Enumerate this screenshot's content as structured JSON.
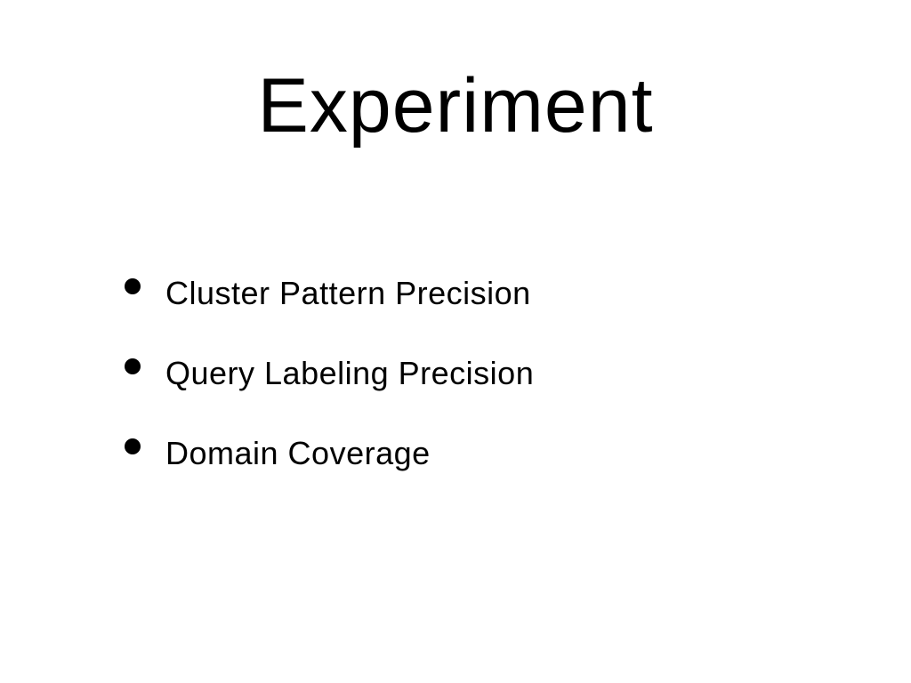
{
  "slide": {
    "title": "Experiment",
    "bullets": [
      {
        "text": "Cluster Pattern Precision"
      },
      {
        "text": "Query Labeling Precision"
      },
      {
        "text": "Domain Coverage"
      }
    ]
  }
}
